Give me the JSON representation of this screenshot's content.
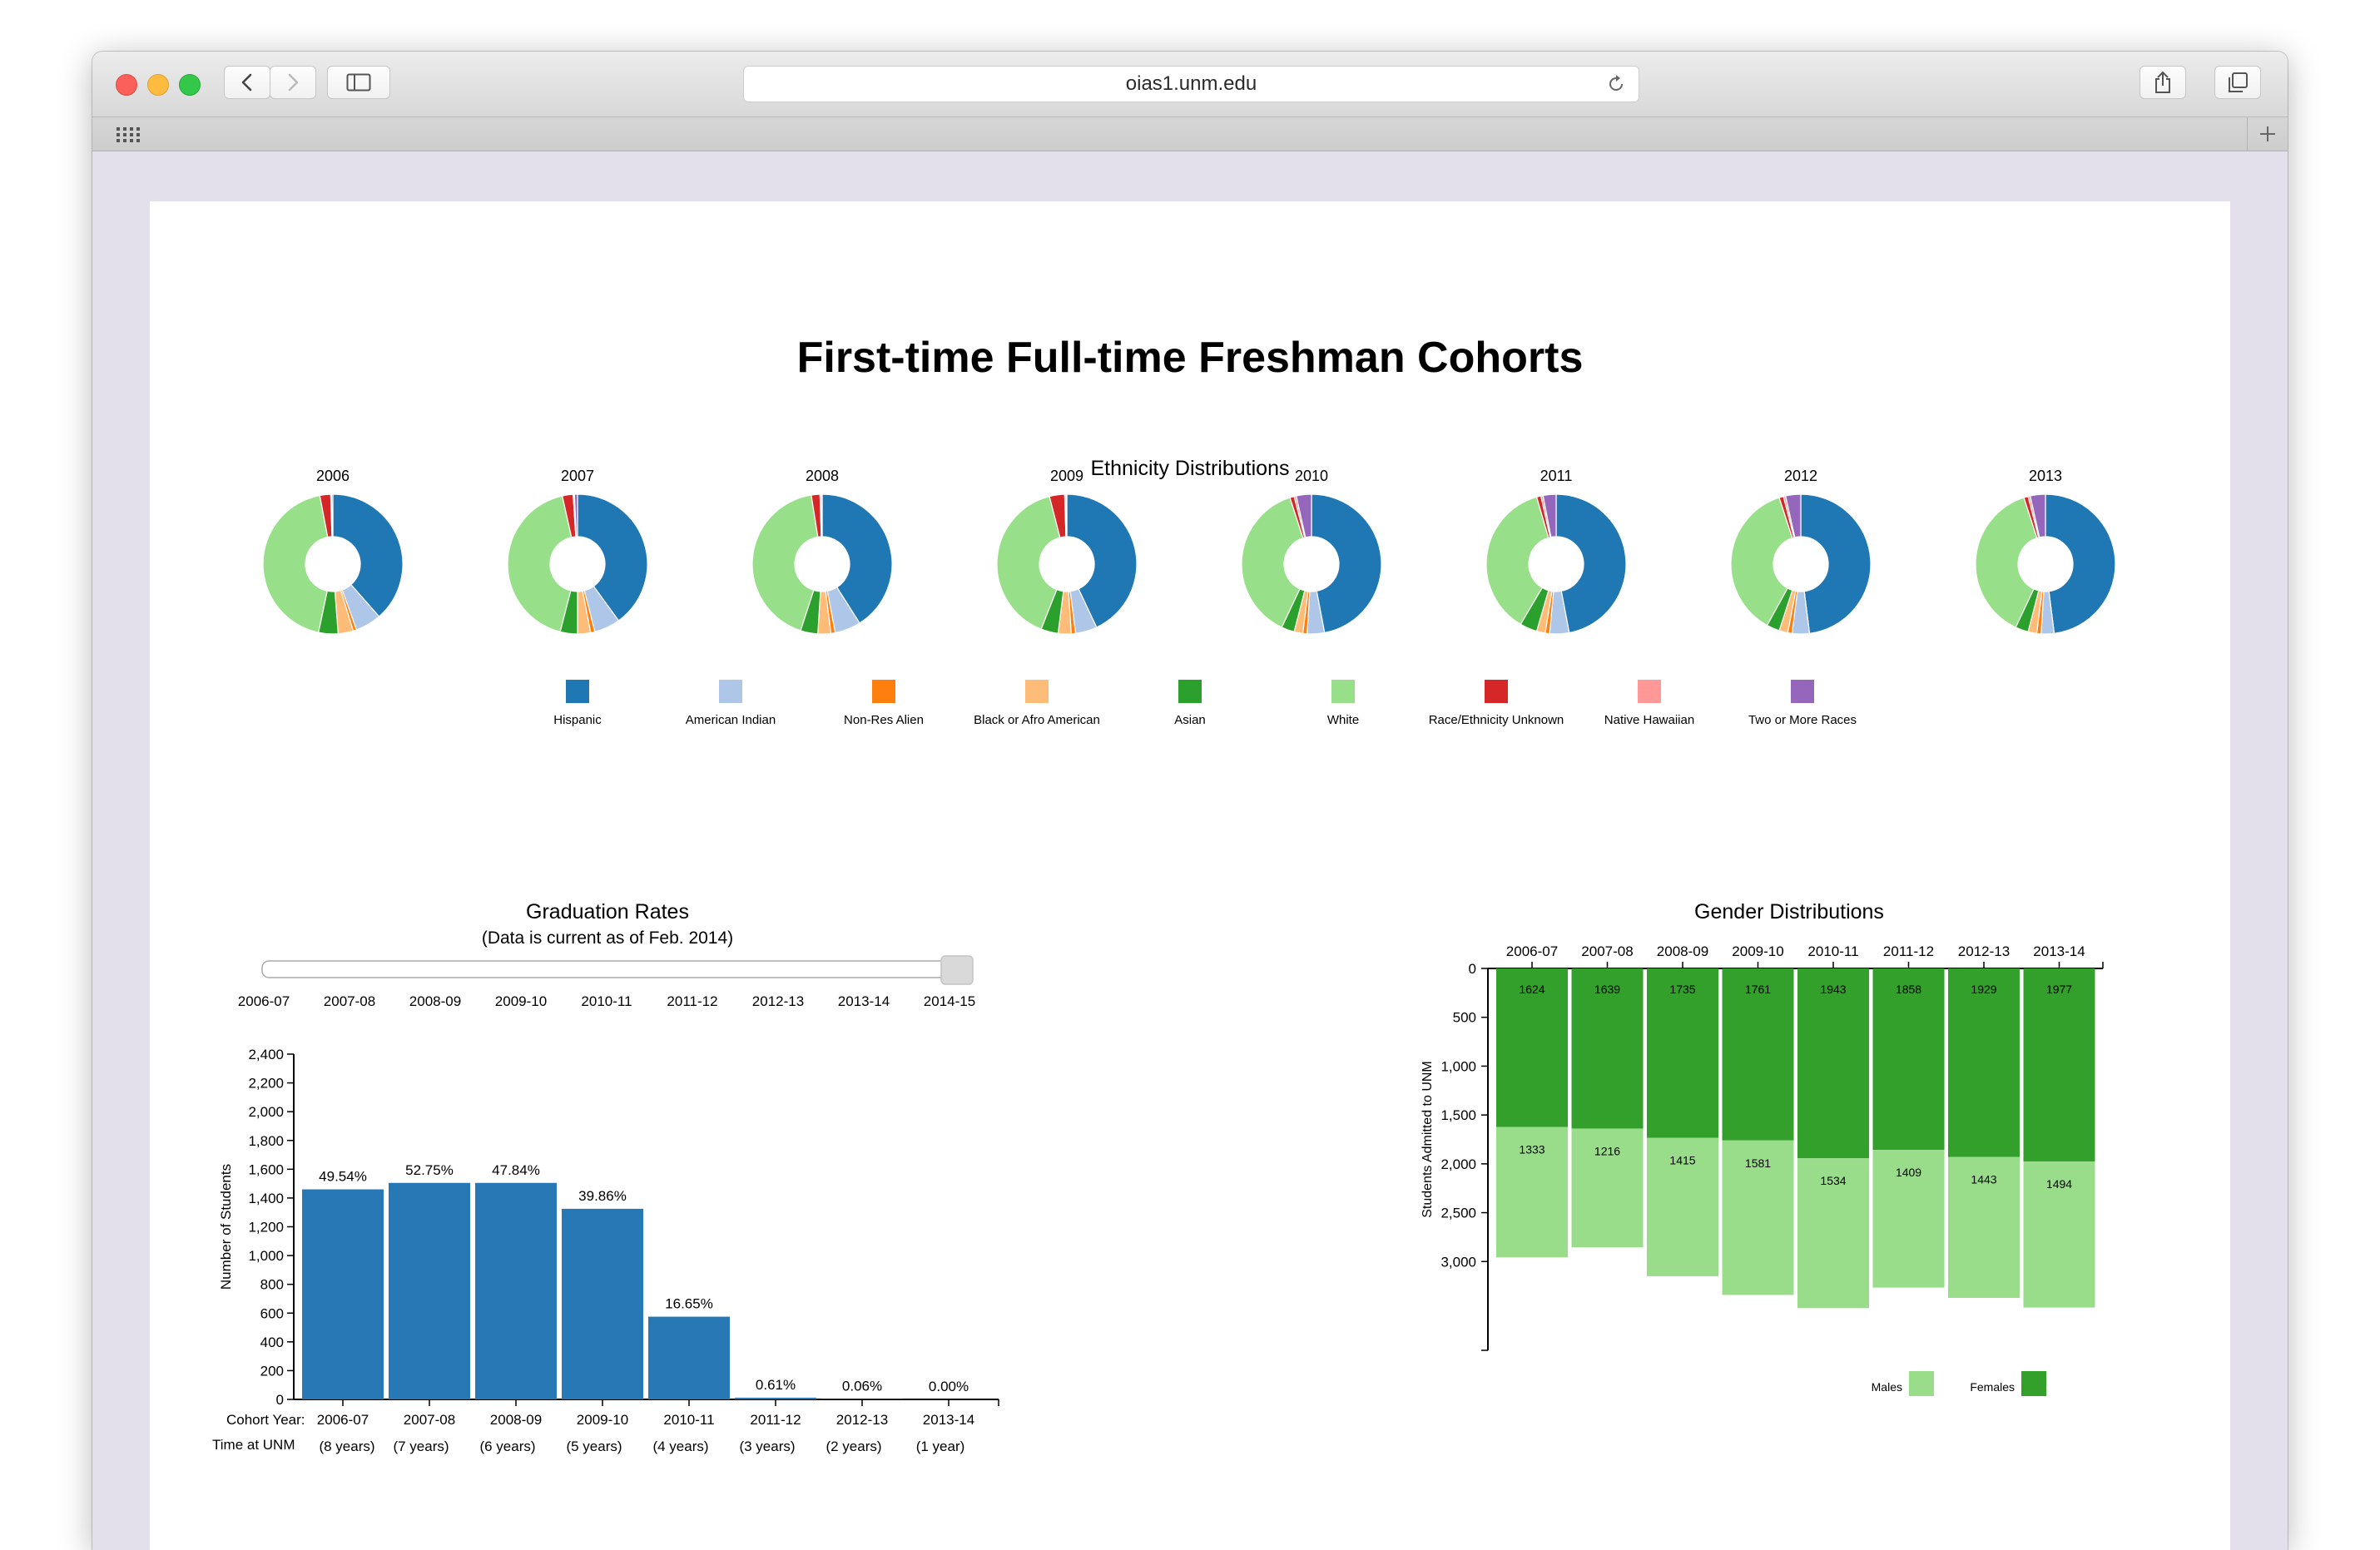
{
  "browser": {
    "url": "oias1.unm.edu"
  },
  "page": {
    "title": "First-time Full-time Freshman Cohorts"
  },
  "ethnicity": {
    "title": "Ethnicity Distributions",
    "categories": [
      "Hispanic",
      "American Indian",
      "Non-Res Alien",
      "Black or Afro American",
      "Asian",
      "White",
      "Race/Ethnicity Unknown",
      "Native Hawaiian",
      "Two or More Races"
    ],
    "colors": [
      "#1f77b4",
      "#aec7e8",
      "#ff7f0e",
      "#ffbb78",
      "#2ca02c",
      "#98df8a",
      "#d62728",
      "#ff9896",
      "#9467bd"
    ],
    "years": [
      {
        "year": "2006",
        "shares": [
          38.5,
          6.0,
          0.8,
          3.5,
          4.5,
          43.7,
          2.5,
          0.2,
          0.3
        ]
      },
      {
        "year": "2007",
        "shares": [
          40.0,
          6.0,
          1.0,
          3.0,
          4.0,
          42.5,
          2.5,
          0.3,
          0.7
        ]
      },
      {
        "year": "2008",
        "shares": [
          41.0,
          6.0,
          1.0,
          3.0,
          4.0,
          42.5,
          2.0,
          0.3,
          0.2
        ]
      },
      {
        "year": "2009",
        "shares": [
          43.0,
          5.0,
          1.0,
          3.0,
          4.0,
          40.0,
          3.5,
          0.3,
          0.2
        ]
      },
      {
        "year": "2010",
        "shares": [
          47.0,
          4.0,
          1.0,
          2.0,
          3.0,
          38.0,
          1.0,
          0.5,
          3.5
        ]
      },
      {
        "year": "2011",
        "shares": [
          47.0,
          4.5,
          1.0,
          2.0,
          4.0,
          37.0,
          1.0,
          0.5,
          3.0
        ]
      },
      {
        "year": "2012",
        "shares": [
          48.0,
          4.0,
          1.0,
          2.0,
          3.0,
          37.0,
          1.0,
          0.5,
          3.5
        ]
      },
      {
        "year": "2013",
        "shares": [
          48.0,
          3.0,
          1.0,
          2.0,
          3.0,
          38.0,
          1.0,
          0.5,
          3.5
        ]
      }
    ]
  },
  "graduation": {
    "title": "Graduation Rates",
    "subtitle": "(Data is current as of Feb. 2014)",
    "slider": {
      "labels": [
        "2006-07",
        "2007-08",
        "2008-09",
        "2009-10",
        "2010-11",
        "2011-12",
        "2012-13",
        "2013-14",
        "2014-15"
      ],
      "value": "2014-15"
    }
  },
  "gender": {
    "title": "Gender Distributions",
    "legend": [
      "Males",
      "Females"
    ]
  },
  "chart_data": [
    {
      "type": "bar",
      "title": "Graduation Rates",
      "ylabel": "Number of Students",
      "xlabel_prefix": "Cohort Year:",
      "row2_prefix": "Time at UNM",
      "categories": [
        "2006-07",
        "2007-08",
        "2008-09",
        "2009-10",
        "2010-11",
        "2011-12",
        "2012-13",
        "2013-14"
      ],
      "time_labels": [
        "(8 years)",
        "(7 years)",
        "(6 years)",
        "(5 years)",
        "(4 years)",
        "(3 years)",
        "(2 years)",
        "(1 year)"
      ],
      "values": [
        1460,
        1505,
        1505,
        1325,
        575,
        12,
        2,
        0
      ],
      "data_labels": [
        "49.54%",
        "52.75%",
        "47.84%",
        "39.86%",
        "16.65%",
        "0.61%",
        "0.06%",
        "0.00%"
      ],
      "ylim": [
        0,
        2400
      ],
      "yticks": [
        0,
        200,
        400,
        600,
        800,
        "1,000",
        "1,200",
        "1,400",
        "1,600",
        "1,800",
        "2,000",
        "2,200",
        "2,400"
      ],
      "color": "#2878b5"
    },
    {
      "type": "bar",
      "stacked": true,
      "title": "Gender Distributions",
      "ylabel": "Students Admitted to UNM",
      "categories": [
        "2006-07",
        "2007-08",
        "2008-09",
        "2009-10",
        "2010-11",
        "2011-12",
        "2012-13",
        "2013-14"
      ],
      "series": [
        {
          "name": "Females",
          "values": [
            1624,
            1639,
            1735,
            1761,
            1943,
            1858,
            1929,
            1977
          ],
          "color": "#33a02c"
        },
        {
          "name": "Males",
          "values": [
            1333,
            1216,
            1415,
            1581,
            1534,
            1409,
            1443,
            1494
          ],
          "color": "#99dd8b"
        }
      ],
      "ylim": [
        0,
        3500
      ],
      "yticks": [
        "0",
        "500",
        "1,000",
        "1,500",
        "2,000",
        "2,500",
        "3,000"
      ],
      "axis_orientation": "top, inverted y"
    }
  ]
}
